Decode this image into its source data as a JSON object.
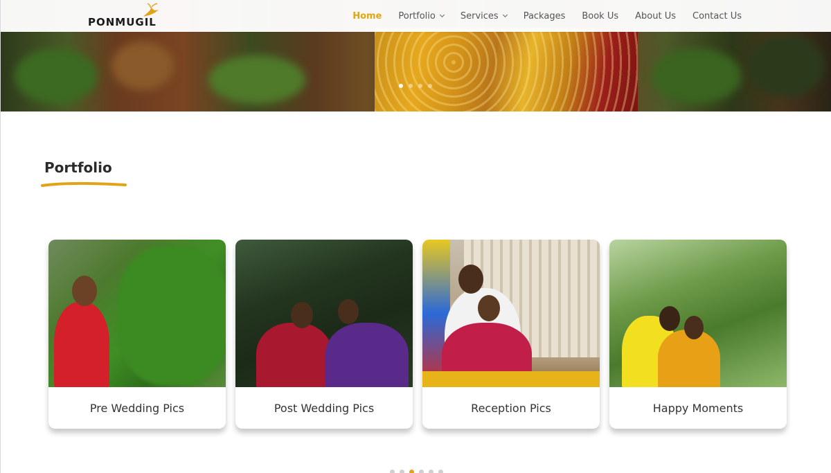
{
  "header": {
    "logo_text": "PONMUGIL",
    "nav": [
      {
        "label": "Home",
        "active": true,
        "dropdown": false
      },
      {
        "label": "Portfolio",
        "active": false,
        "dropdown": true
      },
      {
        "label": "Services",
        "active": false,
        "dropdown": true
      },
      {
        "label": "Packages",
        "active": false,
        "dropdown": false
      },
      {
        "label": "Book Us",
        "active": false,
        "dropdown": false
      },
      {
        "label": "About Us",
        "active": false,
        "dropdown": false
      },
      {
        "label": "Contact Us",
        "active": false,
        "dropdown": false
      }
    ]
  },
  "hero": {
    "slide_count": 4,
    "active_slide": 1
  },
  "portfolio": {
    "title": "Portfolio",
    "cards": [
      {
        "title": "Pre Wedding Pics"
      },
      {
        "title": "Post Wedding Pics"
      },
      {
        "title": "Reception Pics"
      },
      {
        "title": "Happy Moments"
      }
    ],
    "carousel_dot_count": 6,
    "carousel_active_dot": 3
  },
  "colors": {
    "accent": "#e2a417",
    "nav_text": "#555555",
    "title_text": "#2b2b2b"
  }
}
